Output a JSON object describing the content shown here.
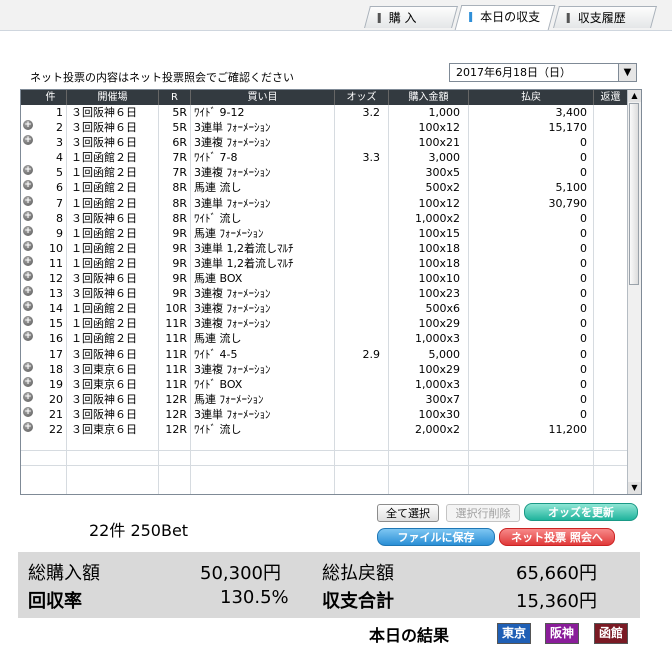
{
  "tabs": [
    {
      "label": "購 入",
      "active": false
    },
    {
      "label": "本日の収支",
      "active": true
    },
    {
      "label": "収支履歴",
      "active": false
    }
  ],
  "info_text": "ネット投票の内容はネット投票照会でご確認ください",
  "date_select": {
    "value": "2017年6月18日（日）"
  },
  "table": {
    "headers": [
      "件",
      "開催場",
      "R",
      "買い目",
      "オッズ",
      "購入金額",
      "払戻",
      "返還"
    ],
    "rows": [
      {
        "no": "1",
        "venue": "３回阪神６日",
        "race": "5R",
        "bet": "ﾜｲﾄﾞ 9-12",
        "odds": "3.2",
        "amount": "1,000",
        "payout": "3,400",
        "expand": false
      },
      {
        "no": "2",
        "venue": "３回阪神６日",
        "race": "5R",
        "bet": "3連単 ﾌｫｰﾒｰｼｮﾝ",
        "odds": "",
        "amount": "100x12",
        "payout": "15,170",
        "expand": true
      },
      {
        "no": "3",
        "venue": "３回阪神６日",
        "race": "6R",
        "bet": "3連複 ﾌｫｰﾒｰｼｮﾝ",
        "odds": "",
        "amount": "100x21",
        "payout": "0",
        "expand": true
      },
      {
        "no": "4",
        "venue": "１回函館２日",
        "race": "7R",
        "bet": "ﾜｲﾄﾞ 7-8",
        "odds": "3.3",
        "amount": "3,000",
        "payout": "0",
        "expand": false
      },
      {
        "no": "5",
        "venue": "１回函館２日",
        "race": "7R",
        "bet": "3連複 ﾌｫｰﾒｰｼｮﾝ",
        "odds": "",
        "amount": "300x5",
        "payout": "0",
        "expand": true
      },
      {
        "no": "6",
        "venue": "１回函館２日",
        "race": "8R",
        "bet": "馬連 流し",
        "odds": "",
        "amount": "500x2",
        "payout": "5,100",
        "expand": true
      },
      {
        "no": "7",
        "venue": "１回函館２日",
        "race": "8R",
        "bet": "3連単 ﾌｫｰﾒｰｼｮﾝ",
        "odds": "",
        "amount": "100x12",
        "payout": "30,790",
        "expand": true
      },
      {
        "no": "8",
        "venue": "３回阪神６日",
        "race": "8R",
        "bet": "ﾜｲﾄﾞ 流し",
        "odds": "",
        "amount": "1,000x2",
        "payout": "0",
        "expand": true
      },
      {
        "no": "9",
        "venue": "１回函館２日",
        "race": "9R",
        "bet": "馬連 ﾌｫｰﾒｰｼｮﾝ",
        "odds": "",
        "amount": "100x15",
        "payout": "0",
        "expand": true
      },
      {
        "no": "10",
        "venue": "１回函館２日",
        "race": "9R",
        "bet": "3連単 1,2着流しﾏﾙﾁ",
        "odds": "",
        "amount": "100x18",
        "payout": "0",
        "expand": true
      },
      {
        "no": "11",
        "venue": "１回函館２日",
        "race": "9R",
        "bet": "3連単 1,2着流しﾏﾙﾁ",
        "odds": "",
        "amount": "100x18",
        "payout": "0",
        "expand": true
      },
      {
        "no": "12",
        "venue": "３回阪神６日",
        "race": "9R",
        "bet": "馬連 BOX",
        "odds": "",
        "amount": "100x10",
        "payout": "0",
        "expand": true
      },
      {
        "no": "13",
        "venue": "３回阪神６日",
        "race": "9R",
        "bet": "3連複 ﾌｫｰﾒｰｼｮﾝ",
        "odds": "",
        "amount": "100x23",
        "payout": "0",
        "expand": true
      },
      {
        "no": "14",
        "venue": "１回函館２日",
        "race": "10R",
        "bet": "3連複 ﾌｫｰﾒｰｼｮﾝ",
        "odds": "",
        "amount": "500x6",
        "payout": "0",
        "expand": true
      },
      {
        "no": "15",
        "venue": "１回函館２日",
        "race": "11R",
        "bet": "3連複 ﾌｫｰﾒｰｼｮﾝ",
        "odds": "",
        "amount": "100x29",
        "payout": "0",
        "expand": true
      },
      {
        "no": "16",
        "venue": "１回函館２日",
        "race": "11R",
        "bet": "馬連 流し",
        "odds": "",
        "amount": "1,000x3",
        "payout": "0",
        "expand": true
      },
      {
        "no": "17",
        "venue": "３回阪神６日",
        "race": "11R",
        "bet": "ﾜｲﾄﾞ 4-5",
        "odds": "2.9",
        "amount": "5,000",
        "payout": "0",
        "expand": false
      },
      {
        "no": "18",
        "venue": "３回東京６日",
        "race": "11R",
        "bet": "3連複 ﾌｫｰﾒｰｼｮﾝ",
        "odds": "",
        "amount": "100x29",
        "payout": "0",
        "expand": true
      },
      {
        "no": "19",
        "venue": "３回東京６日",
        "race": "11R",
        "bet": "ﾜｲﾄﾞ BOX",
        "odds": "",
        "amount": "1,000x3",
        "payout": "0",
        "expand": true
      },
      {
        "no": "20",
        "venue": "３回阪神６日",
        "race": "12R",
        "bet": "馬連 ﾌｫｰﾒｰｼｮﾝ",
        "odds": "",
        "amount": "300x7",
        "payout": "0",
        "expand": true
      },
      {
        "no": "21",
        "venue": "３回阪神６日",
        "race": "12R",
        "bet": "3連単 ﾌｫｰﾒｰｼｮﾝ",
        "odds": "",
        "amount": "100x30",
        "payout": "0",
        "expand": true
      },
      {
        "no": "22",
        "venue": "３回東京６日",
        "race": "12R",
        "bet": "ﾜｲﾄﾞ 流し",
        "odds": "",
        "amount": "2,000x2",
        "payout": "11,200",
        "expand": true
      }
    ]
  },
  "buttons": {
    "select_all": "全て選択",
    "delete_selected": "選択行削除",
    "update_odds": "オッズを更新",
    "save_file": "ファイルに保存",
    "net_query": "ネット投票 照会へ"
  },
  "count_text": "22件 250Bet",
  "summary": {
    "total_purchase_label": "総購入額",
    "total_purchase_value": "50,300円",
    "total_payout_label": "総払戻額",
    "total_payout_value": "65,660円",
    "recovery_label": "回収率",
    "recovery_value": "130.5%",
    "balance_label": "収支合計",
    "balance_value": "15,360円"
  },
  "result": {
    "label": "本日の結果",
    "venues": [
      {
        "name": "東京",
        "color": "#1f5fb5"
      },
      {
        "name": "阪神",
        "color": "#8a1d9a"
      },
      {
        "name": "函館",
        "color": "#7a1a24"
      }
    ]
  }
}
